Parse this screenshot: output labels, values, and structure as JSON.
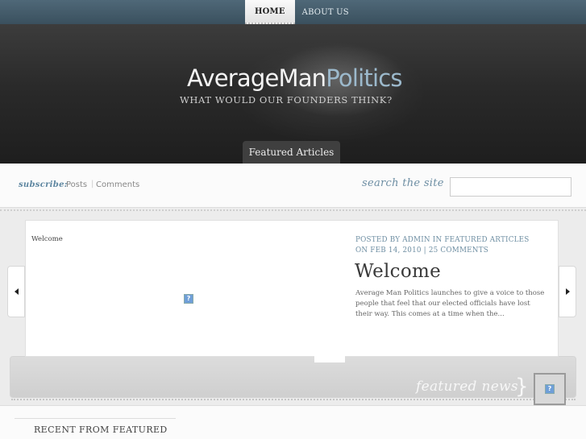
{
  "nav": {
    "items": [
      {
        "label": "HOME",
        "active": true
      },
      {
        "label": "ABOUT US",
        "active": false
      }
    ]
  },
  "header": {
    "logo_part1": "AverageMan",
    "logo_part2": "Politics",
    "tagline": "WHAT WOULD OUR FOUNDERS THINK?",
    "featured_tab": "Featured Articles"
  },
  "subscribe": {
    "label": "subscribe:",
    "posts": "Posts",
    "separator": "|",
    "comments": "Comments"
  },
  "search": {
    "label": "search the site",
    "value": "",
    "placeholder": ""
  },
  "slide": {
    "image_alt": "Welcome",
    "meta": "POSTED BY ADMIN IN FEATURED ARTICLES ON FEB 14, 2010 | 25 COMMENTS",
    "title": "Welcome",
    "excerpt": "Average Man Politics launches to give a voice to those people that feel that our elected officials have lost their way. This comes at a time when the..."
  },
  "featured_news": {
    "label": "featured news",
    "brace": "}"
  },
  "broken_image_glyph": "?",
  "bottom": {
    "recent_heading": "RECENT FROM FEATURED"
  },
  "colors": {
    "accent": "#6f8fa3",
    "nav_bg": "#3a505e",
    "hero_bg": "#2a2a2a",
    "logo_secondary": "#9cb9cc"
  }
}
